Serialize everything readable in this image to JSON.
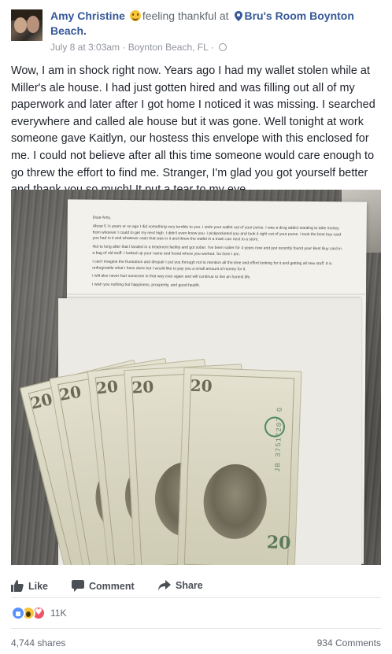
{
  "post": {
    "author": "Amy Christine",
    "feeling": "feeling thankful at",
    "location": "Bru's Room Boynton Beach.",
    "timestamp": "July 8 at 3:03am",
    "place": "Boynton Beach, FL",
    "separator": " · ",
    "audience_icon": "globe-icon",
    "body": "Wow, I am in shock right now. Years ago I had my wallet stolen while at Miller's ale house. I had just gotten hired and was filling out all of my paperwork and later after I got home I noticed it was missing. I searched everywhere and called ale house but it was gone. Well tonight at work someone gave Kaitlyn, our hostess this envelope with this enclosed for me. I could not believe after all this time someone would care enough to go threw the effort to find me. Stranger, I'm glad you got yourself better and thank you so much! It put a tear to my eye"
  },
  "photo": {
    "letter_paragraphs": [
      "Dear Amy,",
      "About 5 ½ years or so ago I did something very terrible to you. I stole your wallet out of your purse. I was a drug addict wanting to take money from whoever I could to get my next high. I didn't even know you. I pickpocketed you and took it right out of your purse. I took the best buy card you had in it and whatever cash that was in it and threw the wallet in a trash can next to a store.",
      "Not to long after that I landed in a treatment facility and got sober. I've been sober for 4 years now and just recently found your Best Buy card in a bag of old stuff. I looked up your name and found where you worked. So here I am.",
      "I can't imagine the frustration and despair I put you through not to mention all the time and effort looking for it and getting all new stuff. It is unforgivable what I have done but I would like to pay you a small amount of money for it.",
      "I will also never hurt someone in that way ever again and will continue to live an honest life.",
      "I wish you nothing but happiness, prosperity, and good health."
    ],
    "bills": [
      {
        "denom": "20",
        "serial": "JB 37517207 G"
      },
      {
        "denom": "20",
        "serial": "JB 37517207 G"
      },
      {
        "denom": "20",
        "serial": "JB 37517207 G"
      },
      {
        "denom": "20",
        "serial": "H 49586235 H"
      },
      {
        "denom": "20",
        "serial": "JB 37517207 G"
      }
    ]
  },
  "actions": {
    "like": "Like",
    "comment": "Comment",
    "share": "Share"
  },
  "reactions": {
    "count": "11K",
    "types": [
      "like-icon",
      "wow-icon",
      "love-icon"
    ]
  },
  "stats": {
    "shares": "4,744 shares",
    "comments": "934 Comments"
  },
  "colors": {
    "link_blue": "#365899",
    "meta_gray": "#90949c",
    "like_blue": "#5890ff",
    "love_red": "#f25268",
    "wow_yellow": "#f7c53a"
  }
}
